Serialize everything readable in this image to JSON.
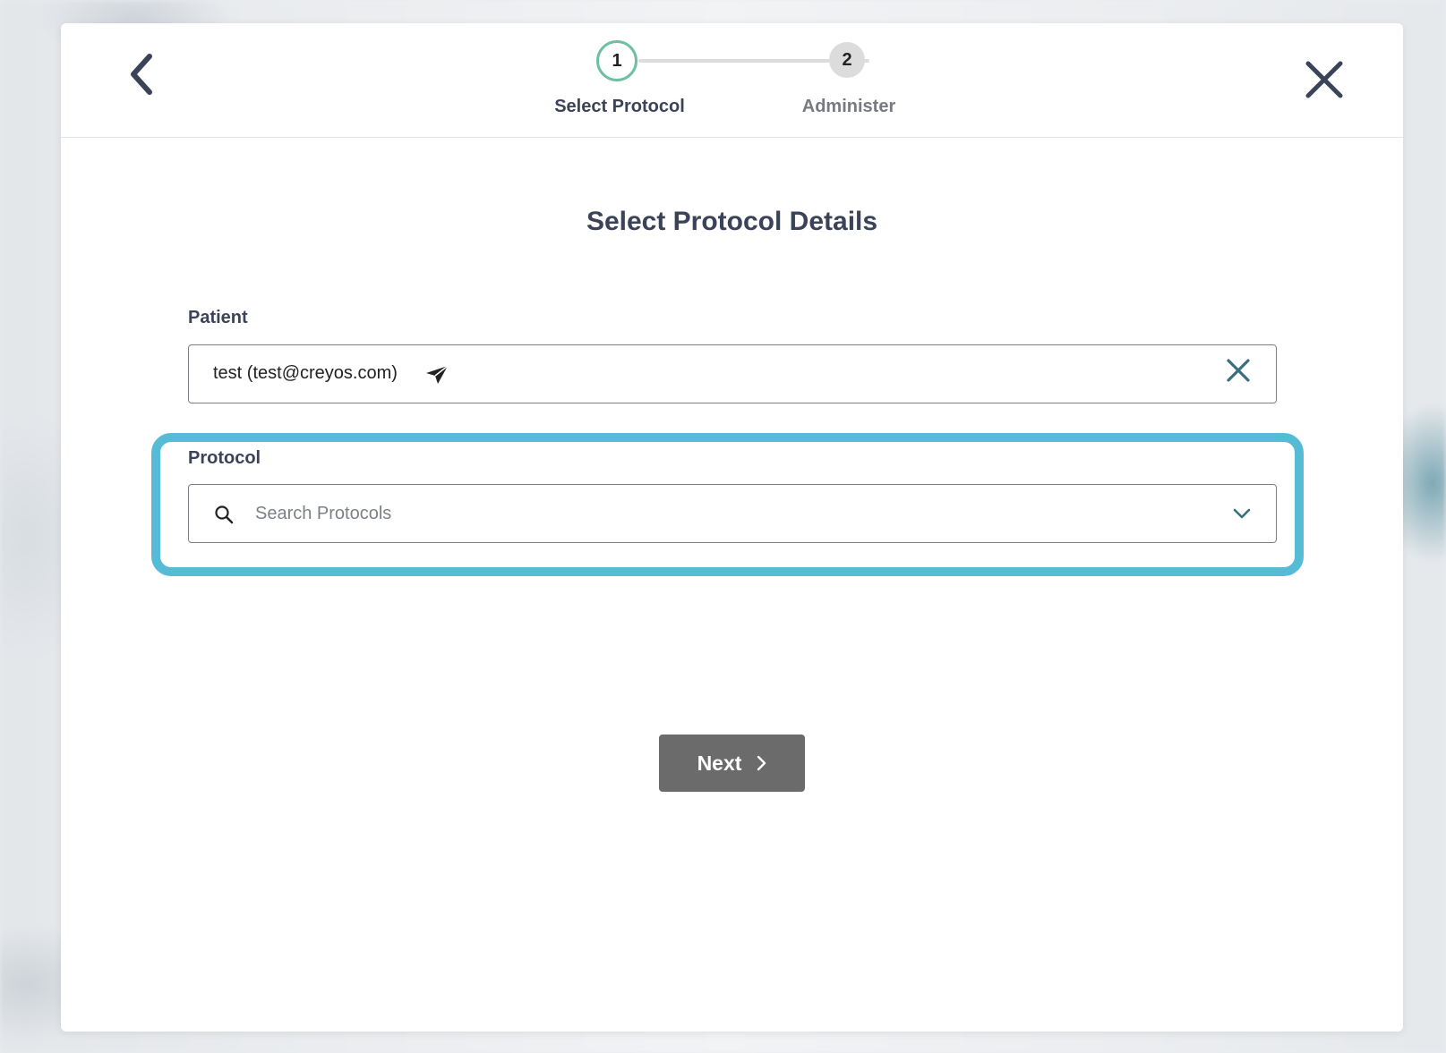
{
  "stepper": {
    "steps": [
      {
        "number": "1",
        "label": "Select Protocol",
        "state": "active"
      },
      {
        "number": "2",
        "label": "Administer",
        "state": "inactive"
      }
    ]
  },
  "page": {
    "title": "Select Protocol Details"
  },
  "patient": {
    "label": "Patient",
    "value": "test (test@creyos.com)"
  },
  "protocol": {
    "label": "Protocol",
    "placeholder": "Search Protocols"
  },
  "footer": {
    "next_label": "Next"
  },
  "colors": {
    "accent_highlight": "#56bcd6",
    "active_step_ring": "#6fc0a0",
    "title_text": "#3b4358",
    "next_button_bg": "#6b6b6b",
    "clear_icon": "#3a6f7e"
  },
  "icons": {
    "back": "chevron-left-icon",
    "close": "close-icon",
    "send": "send-icon",
    "clear": "close-icon",
    "search": "search-icon",
    "dropdown": "chevron-down-icon",
    "next": "chevron-right-icon"
  }
}
